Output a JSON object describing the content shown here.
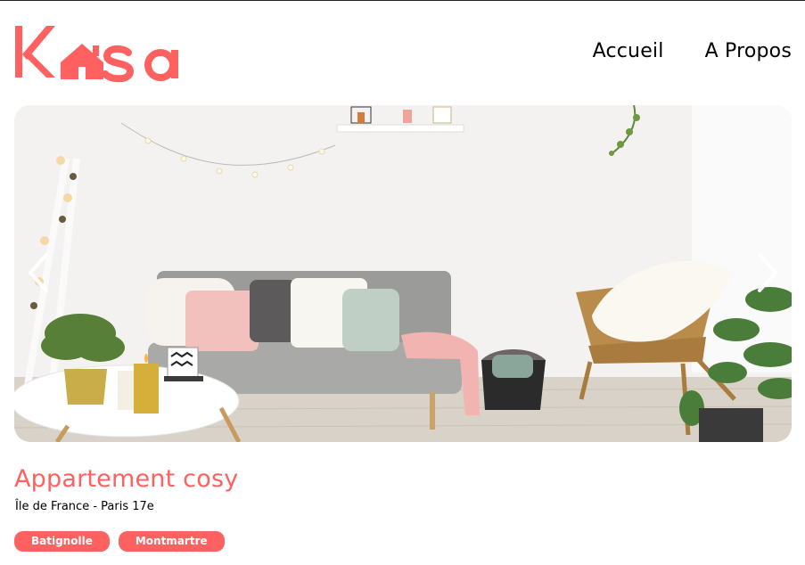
{
  "brand": {
    "logo_text": "Kasa",
    "accent_color": "#ff6060"
  },
  "nav": {
    "items": [
      {
        "label": "Accueil"
      },
      {
        "label": "A Propos"
      }
    ]
  },
  "gallery": {
    "icons": {
      "prev": "chevron-left-icon",
      "next": "chevron-right-icon"
    }
  },
  "listing": {
    "title": "Appartement cosy",
    "location": "Île de France - Paris 17e",
    "tags": [
      "Batignolle",
      "Montmartre"
    ]
  }
}
